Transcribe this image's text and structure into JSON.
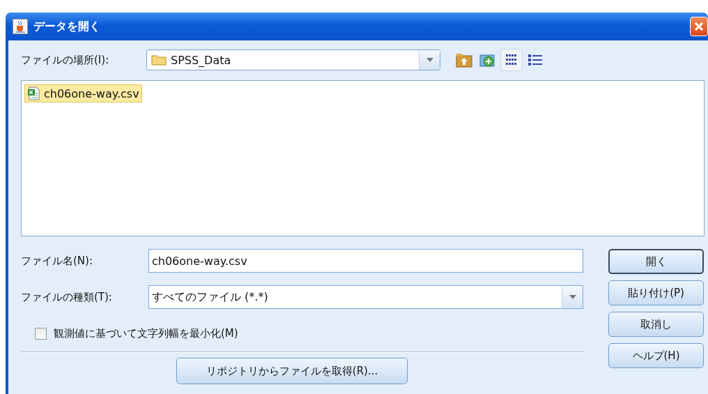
{
  "window": {
    "title": "データを開く"
  },
  "location": {
    "label": "ファイルの場所(I):",
    "value": "SPSS_Data"
  },
  "toolbar": [
    {
      "kind": "up-folder",
      "selected": false
    },
    {
      "kind": "new-folder",
      "selected": false
    },
    {
      "kind": "list-view",
      "selected": true
    },
    {
      "kind": "details-view",
      "selected": false
    }
  ],
  "files": [
    {
      "name": "ch06one-way.csv",
      "selected": true
    }
  ],
  "file_name": {
    "label": "ファイル名(N):",
    "value": "ch06one-way.csv"
  },
  "file_type": {
    "label": "ファイルの種類(T):",
    "value": "すべてのファイル (*.*)"
  },
  "minimize_option": {
    "label": "観測値に基づいて文字列幅を最小化(M)",
    "checked": false
  },
  "repository_button": "リポジトリからファイルを取得(R)...",
  "buttons": [
    {
      "label": "開く",
      "default": true
    },
    {
      "label": "貼り付け(P)",
      "default": false
    },
    {
      "label": "取消し",
      "default": false
    },
    {
      "label": "ヘルプ(H)",
      "default": false
    }
  ]
}
